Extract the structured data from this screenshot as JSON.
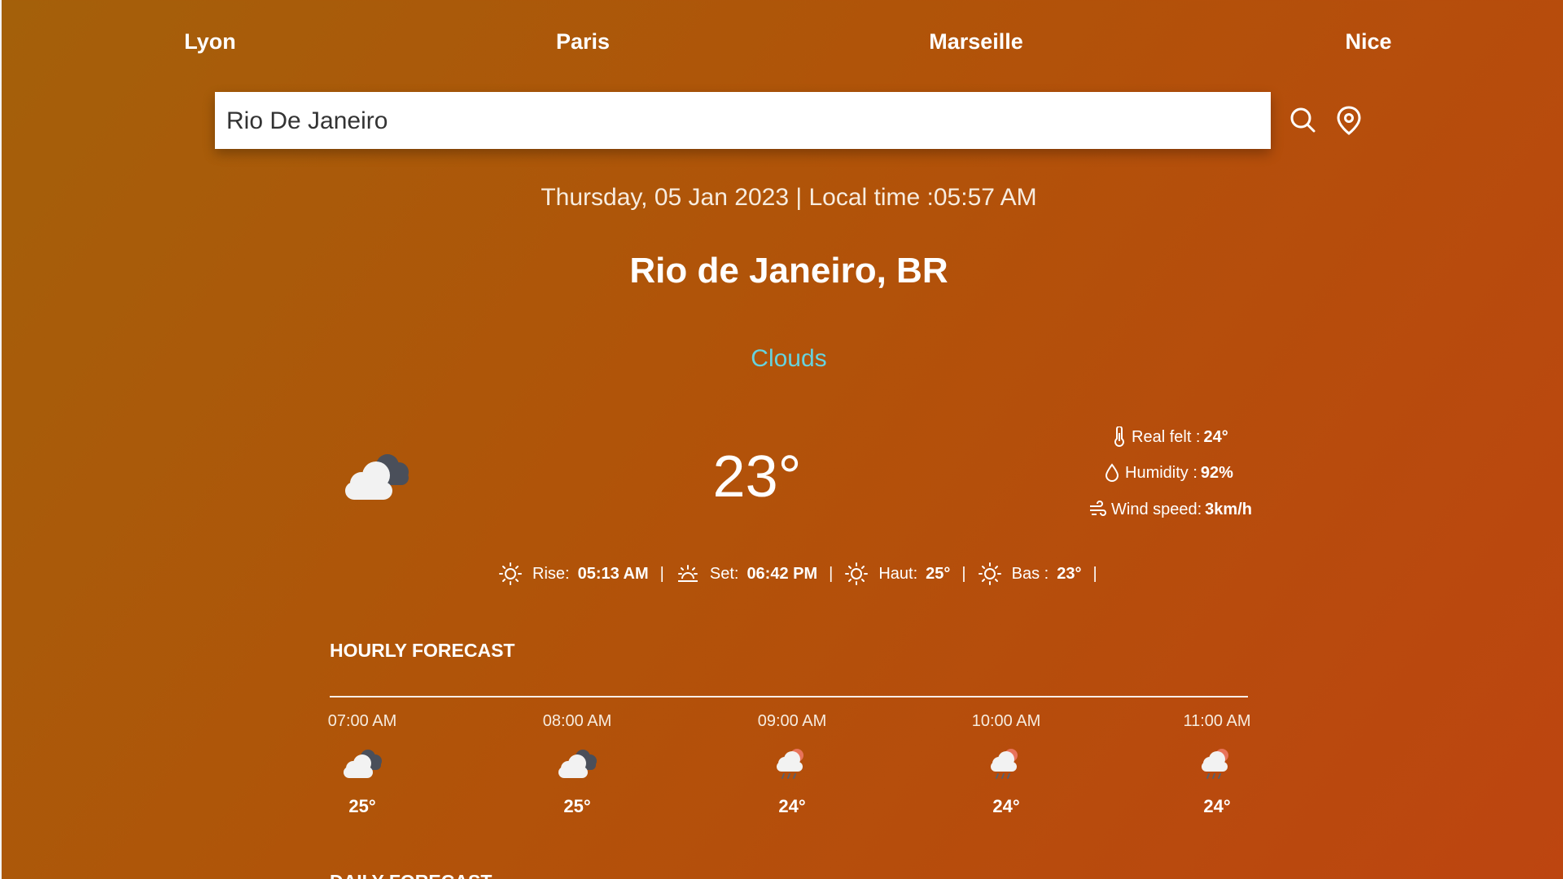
{
  "nav": {
    "cities": [
      "Lyon",
      "Paris",
      "Marseille",
      "Nice"
    ]
  },
  "search": {
    "value": "Rio De Janeiro",
    "search_icon": "search-icon",
    "location_icon": "location-pin-icon"
  },
  "current": {
    "datetime": "Thursday, 05 Jan 2023 | Local time :05:57 AM",
    "city": "Rio de Janeiro, BR",
    "condition": "Clouds",
    "icon": "cloudy-icon",
    "temperature": "23°",
    "details": {
      "real_felt_label": "Real felt :",
      "real_felt_value": "24°",
      "humidity_label": "Humidity :",
      "humidity_value": "92%",
      "wind_label": "Wind speed:",
      "wind_value": "3km/h"
    },
    "sun": {
      "rise_label": "Rise:",
      "rise_value": "05:13 AM",
      "set_label": "Set:",
      "set_value": "06:42 PM",
      "high_label": "Haut:",
      "high_value": "25°",
      "low_label": "Bas :",
      "low_value": "23°",
      "separator": "|"
    }
  },
  "hourly": {
    "title": "HOURLY FORECAST",
    "items": [
      {
        "time": "07:00 AM",
        "temp": "25°",
        "icon": "cloudy-icon"
      },
      {
        "time": "08:00 AM",
        "temp": "25°",
        "icon": "cloudy-icon"
      },
      {
        "time": "09:00 AM",
        "temp": "24°",
        "icon": "rain-cloud-icon"
      },
      {
        "time": "10:00 AM",
        "temp": "24°",
        "icon": "rain-cloud-icon"
      },
      {
        "time": "11:00 AM",
        "temp": "24°",
        "icon": "rain-cloud-icon"
      }
    ]
  },
  "daily": {
    "title": "DAILY FORECAST"
  },
  "colors": {
    "background_start": "#a4600a",
    "background_end": "#bd4510",
    "condition_text": "#67d2dd"
  }
}
